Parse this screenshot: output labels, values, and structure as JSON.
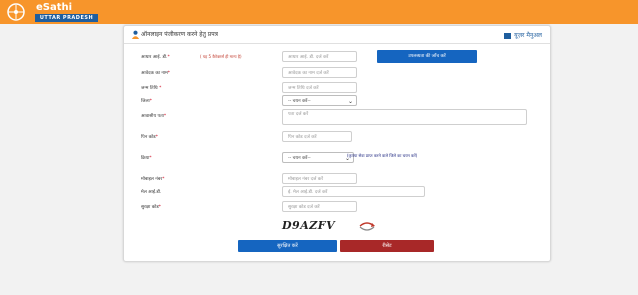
{
  "brand": {
    "title": "eSathi",
    "subtitle": "UTTAR PRADESH"
  },
  "card": {
    "title": "ऑनलाइन पंजीकरण करने हेतु प्रपत्र",
    "manual": "यूज़र मैनुअल"
  },
  "form": {
    "aadhaar": {
      "label": "आधार आई. डी.",
      "hint": "( यह 5 कैरेक्टर्स ही मान्य है)",
      "placeholder": "आधार आई. डी. दर्ज करें"
    },
    "check_button": "उपलब्धता की जाँच करें",
    "applicant_name": {
      "label": "आवेदक का नाम",
      "placeholder": "आवेदक का नाम दर्ज करें"
    },
    "dob": {
      "label": "जन्म तिथि",
      "placeholder": "जन्म तिथि दर्ज करें"
    },
    "district": {
      "label": "जिला",
      "selected": "-- चयन करें--"
    },
    "address": {
      "label": "आवासीय पता",
      "placeholder": "पता दर्ज करें"
    },
    "pincode": {
      "label": "पिन कोड",
      "placeholder": "पिन कोड दर्ज करें"
    },
    "tehsil": {
      "label": "क्रिया",
      "selected": "-- चयन करें--",
      "note": "(कृपया सेवा प्राप्त करने वाले जिले का चयन करें)"
    },
    "mobile": {
      "label": "मोबाइल नंबर",
      "placeholder": "मोबाइल नंबर दर्ज करें"
    },
    "email": {
      "label": "मेल आई.डी.",
      "placeholder": "ई. मेल आई.डी. दर्ज करें"
    },
    "captcha_field": {
      "label": "सुरक्षा कोड",
      "placeholder": "सुरक्षा कोड दर्ज करें"
    },
    "captcha_text": "D9AZFV"
  },
  "buttons": {
    "submit": "सुरक्षित करें",
    "reset": "रीसेट"
  },
  "colors": {
    "header": "#f7952b",
    "primary": "#1565c0",
    "danger": "#a82828",
    "required": "#d0021b"
  },
  "icons": {
    "emblem": "emblem-icon",
    "user": "user-icon",
    "manual": "book-icon",
    "refresh": "refresh-icon",
    "chevron": "chevron-down-icon"
  }
}
